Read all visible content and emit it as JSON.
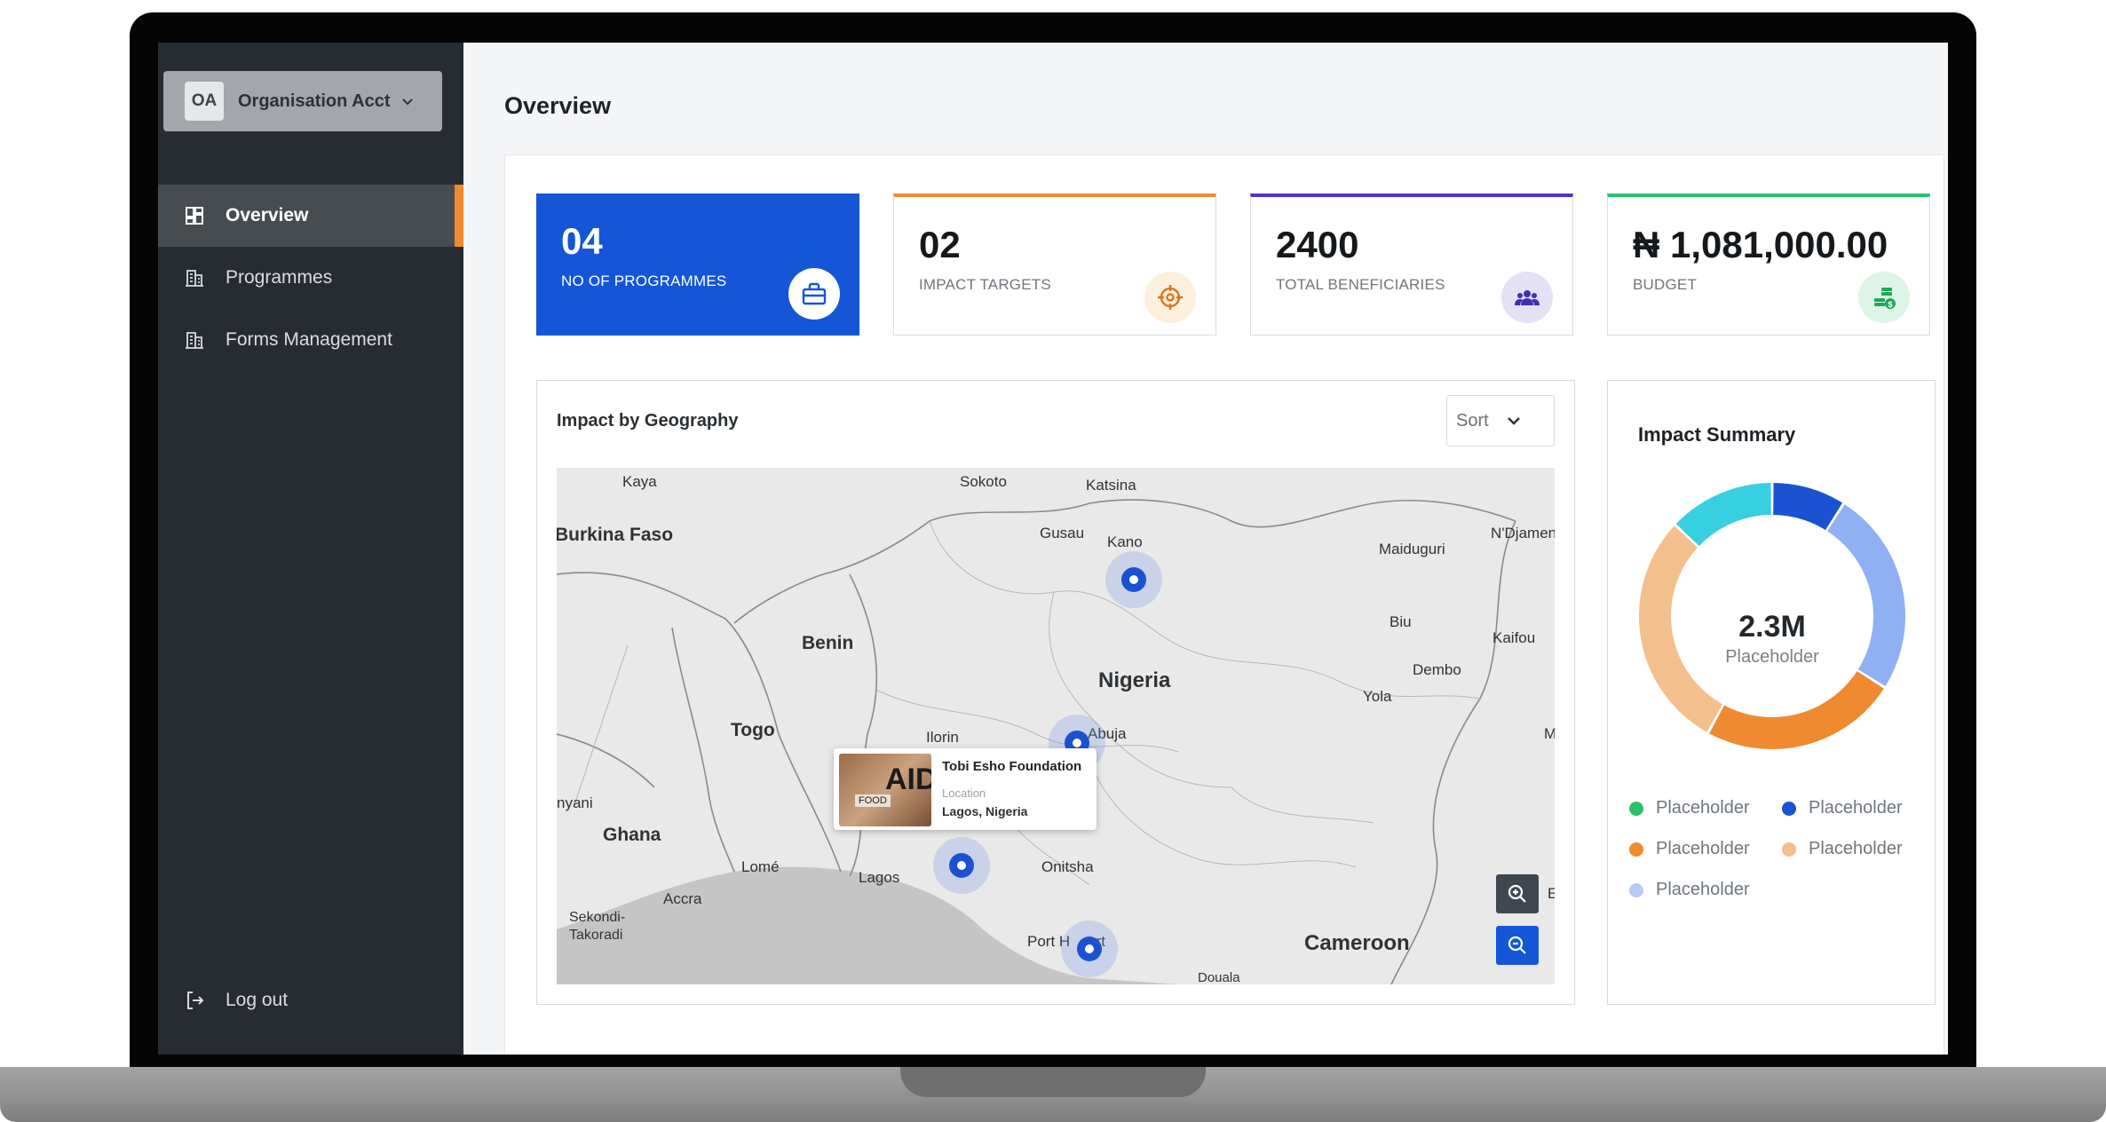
{
  "org": {
    "initials": "OA",
    "name": "Organisation Acct"
  },
  "nav": {
    "items": [
      {
        "label": "Overview",
        "icon": "dashboard-icon",
        "active": true
      },
      {
        "label": "Programmes",
        "icon": "building-icon",
        "active": false
      },
      {
        "label": "Forms Management",
        "icon": "building-icon",
        "active": false
      }
    ],
    "logout": "Log out"
  },
  "page": {
    "title": "Overview"
  },
  "stats": [
    {
      "value": "04",
      "label": "NO OF PROGRAMMES",
      "icon": "basket-icon",
      "accent": "#1456d6"
    },
    {
      "value": "02",
      "label": "IMPACT TARGETS",
      "icon": "target-icon",
      "accent": "#ef8a30"
    },
    {
      "value": "2400",
      "label": "TOTAL BENEFICIARIES",
      "icon": "users-icon",
      "accent": "#4b34d6"
    },
    {
      "value": "₦ 1,081,000.00",
      "label": "BUDGET",
      "icon": "money-icon",
      "accent": "#29c26b"
    }
  ],
  "map": {
    "title": "Impact by Geography",
    "sort_label": "Sort",
    "places": {
      "kaya": "Kaya",
      "sokoto": "Sokoto",
      "katsina": "Katsina",
      "burkina": "Burkina Faso",
      "gusau": "Gusau",
      "kano": "Kano",
      "maiduguri": "Maiduguri",
      "ndjamena": "N'Djamen",
      "benin": "Benin",
      "biu": "Biu",
      "kaifou": "Kaifou",
      "nigeria": "Nigeria",
      "dembo": "Dembo",
      "yola": "Yola",
      "togo": "Togo",
      "ilorin": "Ilorin",
      "abuja": "Abuja",
      "m": "M",
      "nyani": "nyani",
      "ghana": "Ghana",
      "lome": "Lomé",
      "lagos": "Lagos",
      "onitsha": "Onitsha",
      "accra": "Accra",
      "sekondi": "Sekondi-",
      "takoradi": "Takoradi",
      "porth": "Port H",
      "portt": "urt",
      "cameroon": "Cameroon",
      "douala": "Douala",
      "e": "E"
    },
    "tooltip": {
      "name": "Tobi Esho Foundation",
      "location_label": "Location",
      "location": "Lagos, Nigeria",
      "photo_text": "AID",
      "photo_tag": "FOOD"
    }
  },
  "summary": {
    "title": "Impact Summary",
    "center_value": "2.3M",
    "center_label": "Placeholder",
    "legend": [
      {
        "label": "Placeholder",
        "color": "#29c26b"
      },
      {
        "label": "Placeholder",
        "color": "#1a52d1"
      },
      {
        "label": "Placeholder",
        "color": "#ef8a30"
      },
      {
        "label": "Placeholder",
        "color": "#f3bf8c"
      },
      {
        "label": "Placeholder",
        "color": "#b7c9f4"
      }
    ],
    "segments": [
      {
        "name": "blue",
        "value": 9,
        "color": "#1a52d1"
      },
      {
        "name": "light-blue",
        "value": 25,
        "color": "#8fb0f3"
      },
      {
        "name": "orange",
        "value": 24,
        "color": "#ef8a30"
      },
      {
        "name": "peach",
        "value": 29,
        "color": "#f3bf8c"
      },
      {
        "name": "cyan",
        "value": 13,
        "color": "#38cfe0"
      }
    ]
  }
}
